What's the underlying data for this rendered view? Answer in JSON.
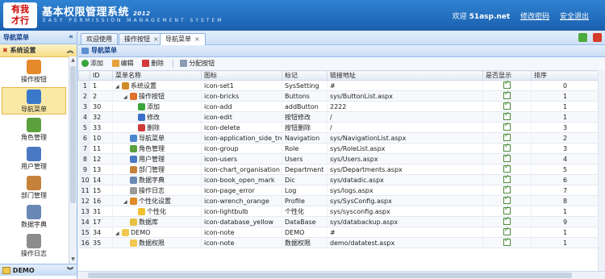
{
  "header": {
    "logo_text": "有我\n才行",
    "title": "基本权限管理系统",
    "version": "2012",
    "subtitle": "EASY PERMISSION MANAGEMENT SYSTEM",
    "welcome": "欢迎 ",
    "user": "51asp.net",
    "change_password": "修改密码",
    "logout": "安全退出"
  },
  "sidebar": {
    "title": "导航菜单",
    "collapse": "«",
    "group": "系统设置",
    "group_chevron": "︽",
    "items": [
      {
        "label": "操作按钮",
        "color": "#e58a2a"
      },
      {
        "label": "导航菜单",
        "color": "#3a78c9"
      },
      {
        "label": "角色管理",
        "color": "#5aa03c"
      },
      {
        "label": "用户管理",
        "color": "#4b78c2"
      },
      {
        "label": "部门管理",
        "color": "#c6813a"
      },
      {
        "label": "数据字典",
        "color": "#6a88b6"
      },
      {
        "label": "操作日志",
        "color": "#8c8c8c"
      }
    ],
    "demo_group": "DEMO",
    "demo_chevron": "︾"
  },
  "tabs": [
    {
      "label": "欢迎使用",
      "closable": false
    },
    {
      "label": "操作按钮",
      "closable": true
    },
    {
      "label": "导航菜单",
      "closable": true
    }
  ],
  "tab_close": "×",
  "grid": {
    "title": "导航菜单",
    "toolbar": {
      "add": "添加",
      "edit": "编辑",
      "delete": "删除",
      "assign": "分配按钮"
    },
    "columns": [
      "ID",
      "菜单名称",
      "图标",
      "标记",
      "链接地址",
      "是否显示",
      "排序"
    ],
    "rows": [
      {
        "rn": "1",
        "id": "1",
        "name": "系统设置",
        "icon": "icon-set1",
        "tag": "SysSetting",
        "url": "#",
        "show": true,
        "sort": "0",
        "level": 0,
        "tri": "◢",
        "ico": "#d08a2a"
      },
      {
        "rn": "2",
        "id": "2",
        "name": "操作按钮",
        "icon": "icon-bricks",
        "tag": "Buttons",
        "url": "sys/ButtonList.aspx",
        "show": true,
        "sort": "1",
        "level": 1,
        "tri": "◢",
        "ico": "#e0702a"
      },
      {
        "rn": "3",
        "id": "30",
        "name": "添加",
        "icon": "icon-add",
        "tag": "addButton",
        "url": "2222",
        "show": true,
        "sort": "1",
        "level": 2,
        "tri": "",
        "ico": "#3aa53a"
      },
      {
        "rn": "4",
        "id": "32",
        "name": "修改",
        "icon": "icon-edit",
        "tag": "按钮修改",
        "url": "/",
        "show": true,
        "sort": "1",
        "level": 2,
        "tri": "",
        "ico": "#3a6fc9"
      },
      {
        "rn": "5",
        "id": "33",
        "name": "删除",
        "icon": "icon-delete",
        "tag": "按钮删除",
        "url": "/",
        "show": true,
        "sort": "3",
        "level": 2,
        "tri": "",
        "ico": "#d23a3a"
      },
      {
        "rn": "6",
        "id": "10",
        "name": "导航菜单",
        "icon": "icon-application_side_tree",
        "tag": "Navigation",
        "url": "sys/NavigationList.aspx",
        "show": true,
        "sort": "2",
        "level": 1,
        "tri": "",
        "ico": "#4a86cf"
      },
      {
        "rn": "7",
        "id": "11",
        "name": "角色管理",
        "icon": "icon-group",
        "tag": "Role",
        "url": "sys/RoleList.aspx",
        "show": true,
        "sort": "3",
        "level": 1,
        "tri": "",
        "ico": "#5aa03c"
      },
      {
        "rn": "8",
        "id": "12",
        "name": "用户管理",
        "icon": "icon-users",
        "tag": "Users",
        "url": "sys/Users.aspx",
        "show": true,
        "sort": "4",
        "level": 1,
        "tri": "",
        "ico": "#4b78c2"
      },
      {
        "rn": "9",
        "id": "13",
        "name": "部门管理",
        "icon": "icon-chart_organisation",
        "tag": "Department",
        "url": "sys/Departments.aspx",
        "show": true,
        "sort": "5",
        "level": 1,
        "tri": "",
        "ico": "#c6813a"
      },
      {
        "rn": "10",
        "id": "14",
        "name": "数据字典",
        "icon": "icon-book_open_mark",
        "tag": "Dic",
        "url": "sys/datadic.aspx",
        "show": true,
        "sort": "6",
        "level": 1,
        "tri": "",
        "ico": "#6a88b6"
      },
      {
        "rn": "11",
        "id": "15",
        "name": "操作日志",
        "icon": "icon-page_error",
        "tag": "Log",
        "url": "sys/logs.aspx",
        "show": true,
        "sort": "7",
        "level": 1,
        "tri": "",
        "ico": "#9a9a9a"
      },
      {
        "rn": "12",
        "id": "16",
        "name": "个性化设置",
        "icon": "icon-wrench_orange",
        "tag": "Profile",
        "url": "sys/SysConfig.aspx",
        "show": true,
        "sort": "8",
        "level": 1,
        "tri": "◢",
        "ico": "#e08a2a"
      },
      {
        "rn": "13",
        "id": "31",
        "name": "个性化",
        "icon": "icon-lightbulb",
        "tag": "个性化",
        "url": "sys/sysconfig.aspx",
        "show": true,
        "sort": "1",
        "level": 2,
        "tri": "",
        "ico": "#f0c030"
      },
      {
        "rn": "14",
        "id": "17",
        "name": "数据库",
        "icon": "icon-database_yellow",
        "tag": "DataBase",
        "url": "sys/databackup.aspx",
        "show": true,
        "sort": "9",
        "level": 1,
        "tri": "",
        "ico": "#e8c040"
      },
      {
        "rn": "15",
        "id": "34",
        "name": "DEMO",
        "icon": "icon-note",
        "tag": "DEMO",
        "url": "#",
        "show": true,
        "sort": "1",
        "level": 0,
        "tri": "◢",
        "ico": "#f0c850"
      },
      {
        "rn": "16",
        "id": "35",
        "name": "数据权限",
        "icon": "icon-note",
        "tag": "数据权限",
        "url": "demo/datatest.aspx",
        "show": true,
        "sort": "1",
        "level": 1,
        "tri": "",
        "ico": "#f0c850"
      }
    ]
  }
}
